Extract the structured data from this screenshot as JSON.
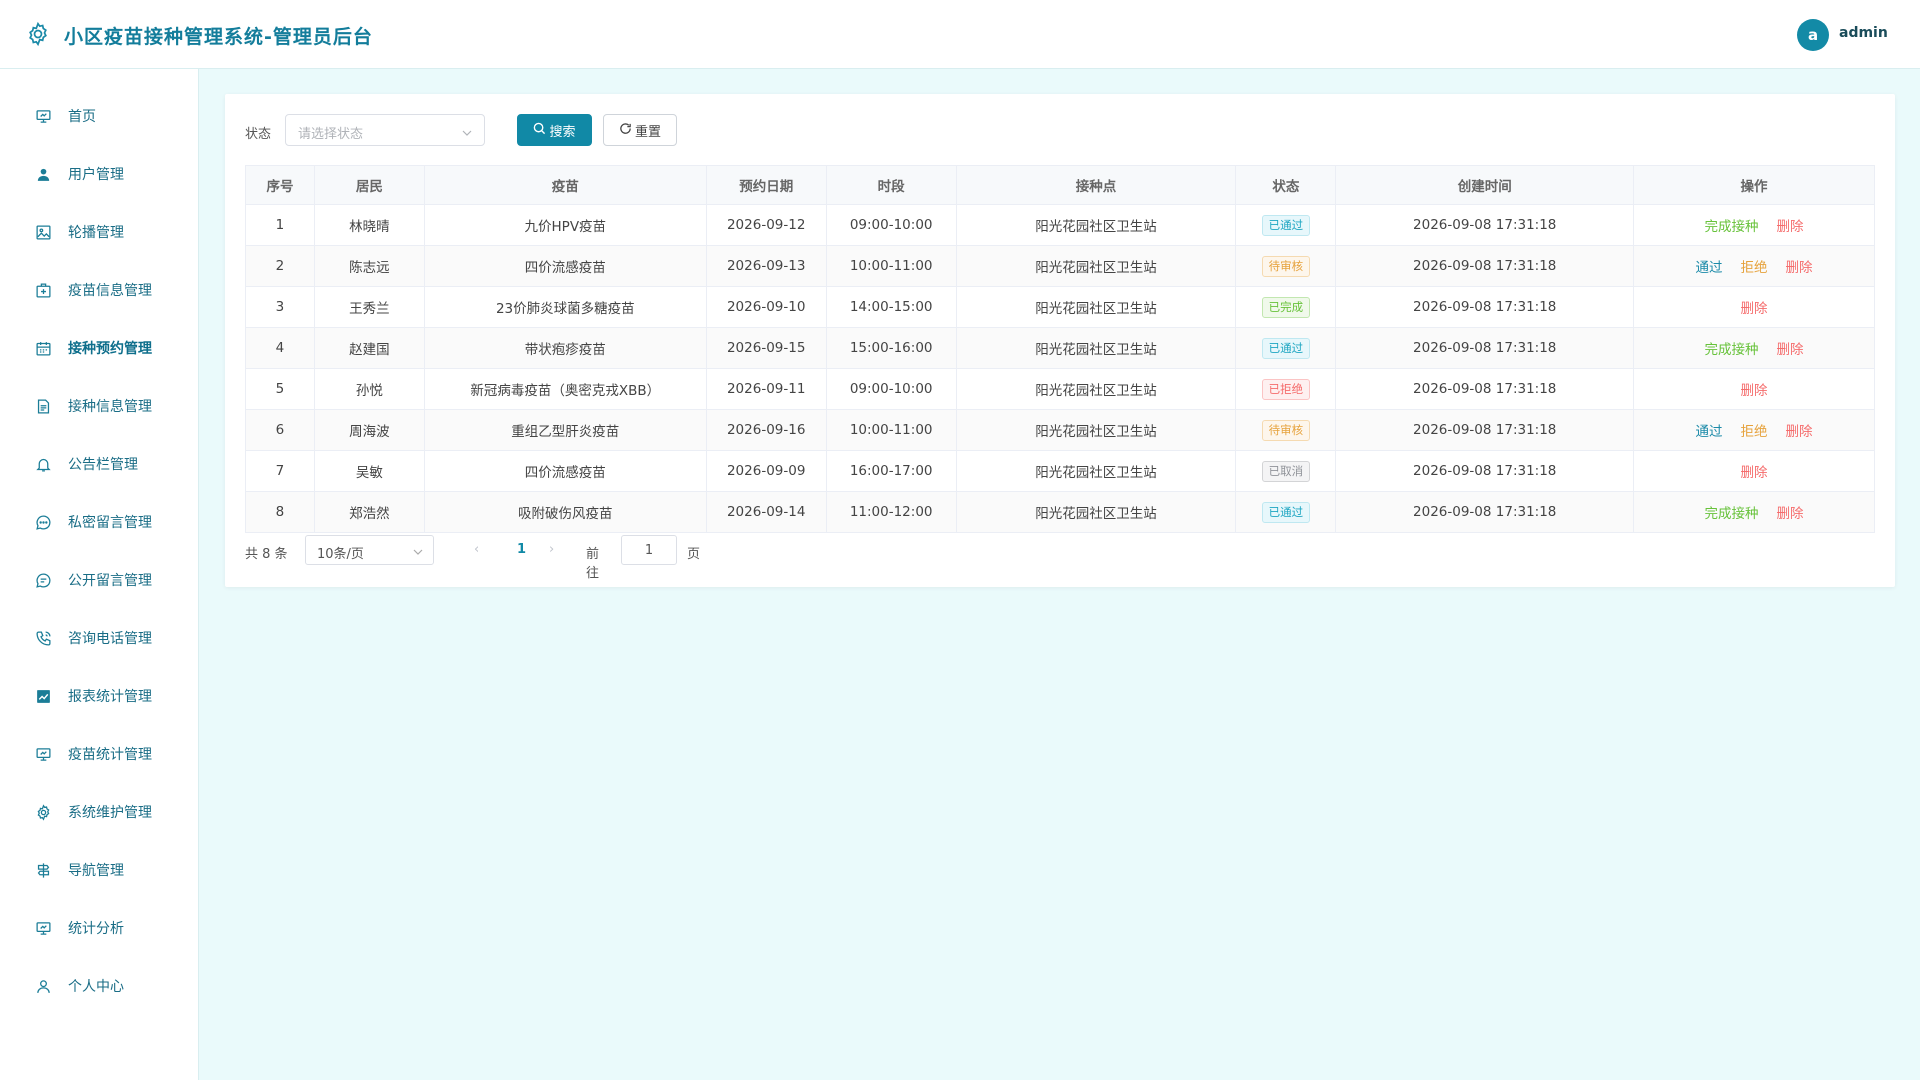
{
  "header": {
    "title": "小区疫苗接种管理系统-管理员后台",
    "avatar_letter": "a",
    "username": "admin"
  },
  "sidebar": {
    "active_index": 4,
    "items": [
      {
        "label": "首页",
        "icon": "dashboard-icon"
      },
      {
        "label": "用户管理",
        "icon": "user-icon"
      },
      {
        "label": "轮播管理",
        "icon": "image-icon"
      },
      {
        "label": "疫苗信息管理",
        "icon": "medicine-box-icon"
      },
      {
        "label": "接种预约管理",
        "icon": "calendar-icon"
      },
      {
        "label": "接种信息管理",
        "icon": "document-icon"
      },
      {
        "label": "公告栏管理",
        "icon": "bell-icon"
      },
      {
        "label": "私密留言管理",
        "icon": "chat-dots-icon"
      },
      {
        "label": "公开留言管理",
        "icon": "chat-line-icon"
      },
      {
        "label": "咨询电话管理",
        "icon": "phone-icon"
      },
      {
        "label": "报表统计管理",
        "icon": "chart-icon"
      },
      {
        "label": "疫苗统计管理",
        "icon": "board-icon"
      },
      {
        "label": "系统维护管理",
        "icon": "gear-icon"
      },
      {
        "label": "导航管理",
        "icon": "guide-icon"
      },
      {
        "label": "统计分析",
        "icon": "stats-board-icon"
      },
      {
        "label": "个人中心",
        "icon": "person-icon"
      }
    ]
  },
  "filter": {
    "label": "状态",
    "placeholder": "请选择状态",
    "search_label": "搜索",
    "reset_label": "重置"
  },
  "table": {
    "headers": [
      "序号",
      "居民",
      "疫苗",
      "预约日期",
      "时段",
      "接种点",
      "状态",
      "创建时间",
      "操作"
    ],
    "rows": [
      {
        "no": "1",
        "resident": "林晓晴",
        "vaccine": "九价HPV疫苗",
        "date": "2026-09-12",
        "slot": "09:00-10:00",
        "site": "阳光花园社区卫生站",
        "status": "已通过",
        "status_type": "pass",
        "created": "2026-09-08 17:31:18",
        "actions": [
          {
            "label": "完成接种",
            "type": "complete"
          },
          {
            "label": "删除",
            "type": "delete"
          }
        ]
      },
      {
        "no": "2",
        "resident": "陈志远",
        "vaccine": "四价流感疫苗",
        "date": "2026-09-13",
        "slot": "10:00-11:00",
        "site": "阳光花园社区卫生站",
        "status": "待审核",
        "status_type": "pending",
        "created": "2026-09-08 17:31:18",
        "actions": [
          {
            "label": "通过",
            "type": "approve"
          },
          {
            "label": "拒绝",
            "type": "reject"
          },
          {
            "label": "删除",
            "type": "delete"
          }
        ]
      },
      {
        "no": "3",
        "resident": "王秀兰",
        "vaccine": "23价肺炎球菌多糖疫苗",
        "date": "2026-09-10",
        "slot": "14:00-15:00",
        "site": "阳光花园社区卫生站",
        "status": "已完成",
        "status_type": "done",
        "created": "2026-09-08 17:31:18",
        "actions": [
          {
            "label": "删除",
            "type": "delete"
          }
        ]
      },
      {
        "no": "4",
        "resident": "赵建国",
        "vaccine": "带状疱疹疫苗",
        "date": "2026-09-15",
        "slot": "15:00-16:00",
        "site": "阳光花园社区卫生站",
        "status": "已通过",
        "status_type": "pass",
        "created": "2026-09-08 17:31:18",
        "actions": [
          {
            "label": "完成接种",
            "type": "complete"
          },
          {
            "label": "删除",
            "type": "delete"
          }
        ]
      },
      {
        "no": "5",
        "resident": "孙悦",
        "vaccine": "新冠病毒疫苗（奥密克戎XBB）",
        "date": "2026-09-11",
        "slot": "09:00-10:00",
        "site": "阳光花园社区卫生站",
        "status": "已拒绝",
        "status_type": "reject",
        "created": "2026-09-08 17:31:18",
        "actions": [
          {
            "label": "删除",
            "type": "delete"
          }
        ]
      },
      {
        "no": "6",
        "resident": "周海波",
        "vaccine": "重组乙型肝炎疫苗",
        "date": "2026-09-16",
        "slot": "10:00-11:00",
        "site": "阳光花园社区卫生站",
        "status": "待审核",
        "status_type": "pending",
        "created": "2026-09-08 17:31:18",
        "actions": [
          {
            "label": "通过",
            "type": "approve"
          },
          {
            "label": "拒绝",
            "type": "reject"
          },
          {
            "label": "删除",
            "type": "delete"
          }
        ]
      },
      {
        "no": "7",
        "resident": "吴敏",
        "vaccine": "四价流感疫苗",
        "date": "2026-09-09",
        "slot": "16:00-17:00",
        "site": "阳光花园社区卫生站",
        "status": "已取消",
        "status_type": "cancel",
        "created": "2026-09-08 17:31:18",
        "actions": [
          {
            "label": "删除",
            "type": "delete"
          }
        ]
      },
      {
        "no": "8",
        "resident": "郑浩然",
        "vaccine": "吸附破伤风疫苗",
        "date": "2026-09-14",
        "slot": "11:00-12:00",
        "site": "阳光花园社区卫生站",
        "status": "已通过",
        "status_type": "pass",
        "created": "2026-09-08 17:31:18",
        "actions": [
          {
            "label": "完成接种",
            "type": "complete"
          },
          {
            "label": "删除",
            "type": "delete"
          }
        ]
      }
    ]
  },
  "pagination": {
    "total_text": "共 8 条",
    "page_size": "10条/页",
    "current_page": "1",
    "goto_label": "前往",
    "goto_value": "1",
    "page_suffix": "页"
  },
  "colors": {
    "accent": "#1189a6",
    "background": "#eafafb"
  }
}
